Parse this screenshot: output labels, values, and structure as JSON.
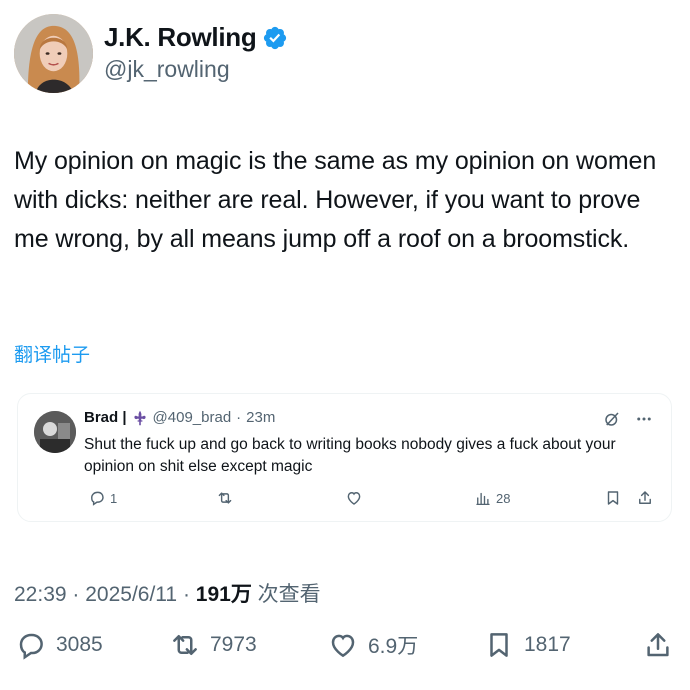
{
  "author": {
    "name": "J.K. Rowling",
    "handle": "@jk_rowling",
    "verified_icon": "verified-badge-icon"
  },
  "tweet": {
    "text": "My opinion on magic is the same as my opinion on women with dicks: neither are real. However, if you want to prove me wrong, by all means jump off a roof on a broomstick.",
    "translate_label": "翻译帖子",
    "time": "22:39",
    "date": "2025/6/11",
    "views_count": "191万",
    "views_label": "次查看",
    "replies": "3085",
    "reposts": "7973",
    "likes": "6.9万",
    "bookmarks": "1817"
  },
  "quote": {
    "name": "Brad |",
    "handle": "@409_brad",
    "time": "23m",
    "text": "Shut the fuck up and go back to writing books nobody gives a fuck about your opinion on shit else except magic",
    "replies": "1",
    "views": "28"
  },
  "colors": {
    "text": "#0f1419",
    "secondary": "#536471",
    "accent": "#1d9bf0",
    "border": "#eff3f4"
  }
}
